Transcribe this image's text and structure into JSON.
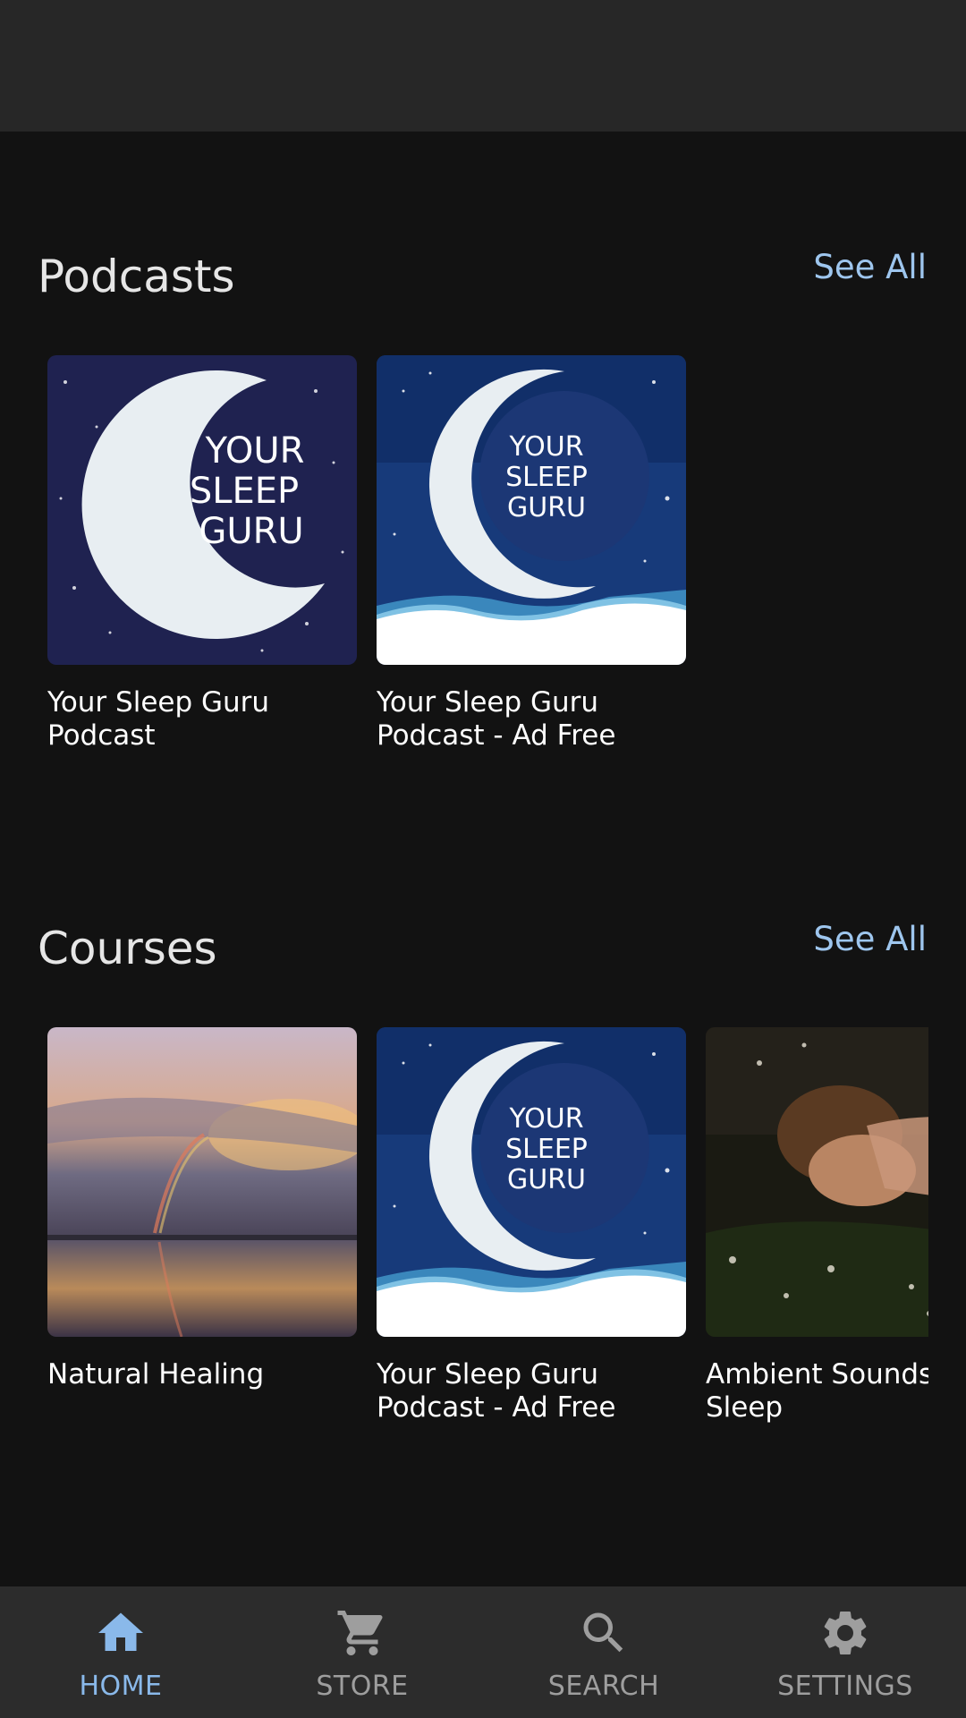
{
  "podcasts": {
    "title": "Podcasts",
    "see_all": "See All",
    "items": [
      {
        "title": "Your Sleep Guru Podcast",
        "image": "moon-art-dark",
        "art_text": [
          "YOUR",
          "SLEEP",
          "GURU"
        ]
      },
      {
        "title": "Your Sleep Guru Podcast - Ad Free",
        "image": "moon-art-blue",
        "art_text": [
          "YOUR",
          "SLEEP",
          "GURU"
        ]
      }
    ]
  },
  "courses": {
    "title": "Courses",
    "see_all": "See All",
    "items": [
      {
        "title": "Natural Healing",
        "image": "rainbow-sunset-lake"
      },
      {
        "title": "Your Sleep Guru Podcast - Ad Free",
        "image": "moon-art-blue",
        "art_text": [
          "YOUR",
          "SLEEP",
          "GURU"
        ]
      },
      {
        "title": "Ambient Sounds Sleep",
        "image": "sleeping-woman-flowers"
      }
    ]
  },
  "nav": {
    "items": [
      {
        "label": "HOME",
        "icon": "home-icon",
        "active": true
      },
      {
        "label": "STORE",
        "icon": "cart-icon",
        "active": false
      },
      {
        "label": "SEARCH",
        "icon": "search-icon",
        "active": false
      },
      {
        "label": "SETTINGS",
        "icon": "gear-icon",
        "active": false
      }
    ]
  },
  "colors": {
    "background": "#121212",
    "app_bar": "#272727",
    "accent": "#8ab9ea",
    "nav_inactive": "#9e9e9e"
  }
}
